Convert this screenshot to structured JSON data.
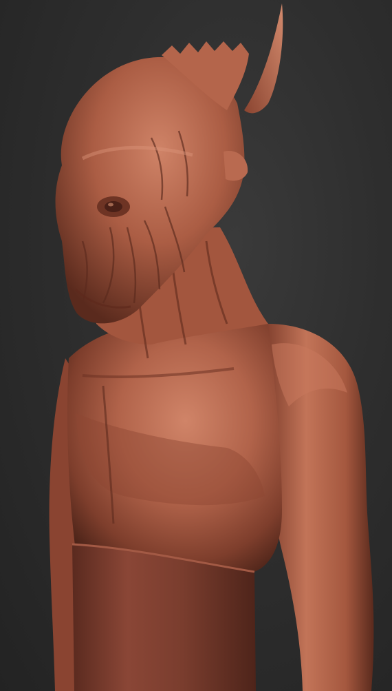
{
  "scene": {
    "subject": "creature-bust-sculpt",
    "colors": {
      "background": "#2b2b2b",
      "clay_light": "#c87a5c",
      "clay_mid": "#a85a40",
      "clay_dark": "#6e3526",
      "clay_shadow": "#4a2218",
      "cloth": "#7a3f30"
    }
  }
}
